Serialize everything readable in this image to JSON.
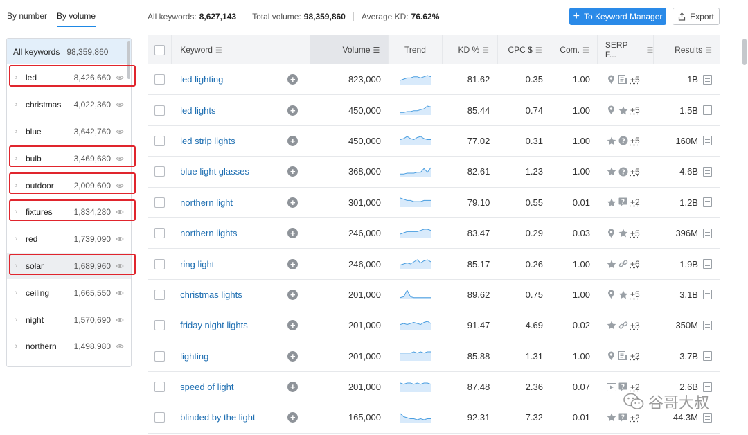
{
  "left_tabs": [
    {
      "label": "By number",
      "active": false
    },
    {
      "label": "By volume",
      "active": true
    }
  ],
  "groups": {
    "all": {
      "name": "All keywords",
      "count": "98,359,860"
    },
    "items": [
      {
        "name": "led",
        "count": "8,426,660",
        "highlighted": true,
        "selected": false
      },
      {
        "name": "christmas",
        "count": "4,022,360",
        "highlighted": false,
        "selected": false
      },
      {
        "name": "blue",
        "count": "3,642,760",
        "highlighted": false,
        "selected": false
      },
      {
        "name": "bulb",
        "count": "3,469,680",
        "highlighted": true,
        "selected": false
      },
      {
        "name": "outdoor",
        "count": "2,009,600",
        "highlighted": true,
        "selected": false
      },
      {
        "name": "fixtures",
        "count": "1,834,280",
        "highlighted": true,
        "selected": false
      },
      {
        "name": "red",
        "count": "1,739,090",
        "highlighted": false,
        "selected": false
      },
      {
        "name": "solar",
        "count": "1,689,960",
        "highlighted": true,
        "selected": true
      },
      {
        "name": "ceiling",
        "count": "1,665,550",
        "highlighted": false,
        "selected": false
      },
      {
        "name": "night",
        "count": "1,570,690",
        "highlighted": false,
        "selected": false
      },
      {
        "name": "northern",
        "count": "1,498,980",
        "highlighted": false,
        "selected": false
      }
    ]
  },
  "stats": {
    "all_keywords_label": "All keywords:",
    "all_keywords_value": "8,627,143",
    "total_volume_label": "Total volume:",
    "total_volume_value": "98,359,860",
    "avg_kd_label": "Average KD:",
    "avg_kd_value": "76.62%"
  },
  "actions": {
    "keyword_manager_label": "To Keyword Manager",
    "export_label": "Export"
  },
  "table": {
    "columns": {
      "keyword": "Keyword",
      "volume": "Volume",
      "trend": "Trend",
      "kd": "KD %",
      "cpc": "CPC $",
      "com": "Com.",
      "serp": "SERP F...",
      "results": "Results"
    },
    "rows": [
      {
        "keyword": "led lighting",
        "volume": "823,000",
        "trend": [
          3,
          4,
          5,
          5,
          6,
          6,
          5,
          6,
          7,
          6
        ],
        "kd": "81.62",
        "cpc": "0.35",
        "com": "1.00",
        "serp_icons": [
          "location-pin-icon",
          "review-icon"
        ],
        "serp_more": "+5",
        "results": "1B"
      },
      {
        "keyword": "led lights",
        "volume": "450,000",
        "trend": [
          2,
          2,
          3,
          3,
          4,
          4,
          5,
          6,
          9,
          8
        ],
        "kd": "85.44",
        "cpc": "0.74",
        "com": "1.00",
        "serp_icons": [
          "location-pin-icon",
          "star-icon"
        ],
        "serp_more": "+5",
        "results": "1.5B"
      },
      {
        "keyword": "led strip lights",
        "volume": "450,000",
        "trend": [
          5,
          6,
          8,
          6,
          5,
          7,
          8,
          6,
          5,
          5
        ],
        "kd": "77.02",
        "cpc": "0.31",
        "com": "1.00",
        "serp_icons": [
          "star-icon",
          "question-icon"
        ],
        "serp_more": "+5",
        "results": "160M"
      },
      {
        "keyword": "blue light glasses",
        "volume": "368,000",
        "trend": [
          2,
          2,
          3,
          3,
          3,
          4,
          4,
          8,
          4,
          9
        ],
        "kd": "82.61",
        "cpc": "1.23",
        "com": "1.00",
        "serp_icons": [
          "star-icon",
          "question-icon"
        ],
        "serp_more": "+5",
        "results": "4.6B"
      },
      {
        "keyword": "northern light",
        "volume": "301,000",
        "trend": [
          7,
          6,
          5,
          5,
          4,
          4,
          4,
          5,
          5,
          5
        ],
        "kd": "79.10",
        "cpc": "0.55",
        "com": "0.01",
        "serp_icons": [
          "star-icon",
          "faq-icon"
        ],
        "serp_more": "+2",
        "results": "1.2B"
      },
      {
        "keyword": "northern lights",
        "volume": "246,000",
        "trend": [
          3,
          4,
          5,
          5,
          5,
          5,
          6,
          7,
          7,
          6
        ],
        "kd": "83.47",
        "cpc": "0.29",
        "com": "0.03",
        "serp_icons": [
          "location-pin-icon",
          "star-icon"
        ],
        "serp_more": "+5",
        "results": "396M"
      },
      {
        "keyword": "ring light",
        "volume": "246,000",
        "trend": [
          3,
          4,
          5,
          4,
          6,
          8,
          5,
          7,
          8,
          6
        ],
        "kd": "85.17",
        "cpc": "0.26",
        "com": "1.00",
        "serp_icons": [
          "star-icon",
          "link-icon"
        ],
        "serp_more": "+6",
        "results": "1.9B"
      },
      {
        "keyword": "christmas lights",
        "volume": "201,000",
        "trend": [
          1,
          2,
          9,
          2,
          1,
          1,
          1,
          1,
          1,
          1
        ],
        "kd": "89.62",
        "cpc": "0.75",
        "com": "1.00",
        "serp_icons": [
          "location-pin-icon",
          "star-icon"
        ],
        "serp_more": "+5",
        "results": "3.1B"
      },
      {
        "keyword": "friday night lights",
        "volume": "201,000",
        "trend": [
          5,
          6,
          5,
          6,
          7,
          6,
          5,
          7,
          8,
          6
        ],
        "kd": "91.47",
        "cpc": "4.69",
        "com": "0.02",
        "serp_icons": [
          "star-icon",
          "link-icon"
        ],
        "serp_more": "+3",
        "results": "350M"
      },
      {
        "keyword": "lighting",
        "volume": "201,000",
        "trend": [
          6,
          6,
          6,
          6,
          7,
          6,
          7,
          6,
          7,
          7
        ],
        "kd": "85.88",
        "cpc": "1.31",
        "com": "1.00",
        "serp_icons": [
          "location-pin-icon",
          "review-icon"
        ],
        "serp_more": "+2",
        "results": "3.7B"
      },
      {
        "keyword": "speed of light",
        "volume": "201,000",
        "trend": [
          7,
          6,
          7,
          7,
          6,
          7,
          6,
          7,
          7,
          6
        ],
        "kd": "87.48",
        "cpc": "2.36",
        "com": "0.07",
        "serp_icons": [
          "video-icon",
          "faq-icon"
        ],
        "serp_more": "+2",
        "results": "2.6B"
      },
      {
        "keyword": "blinded by the light",
        "volume": "165,000",
        "trend": [
          8,
          5,
          4,
          3,
          3,
          2,
          3,
          2,
          3,
          3
        ],
        "kd": "92.31",
        "cpc": "7.32",
        "com": "0.01",
        "serp_icons": [
          "star-icon",
          "faq-icon"
        ],
        "serp_more": "+2",
        "results": "44.3M"
      }
    ]
  },
  "colors": {
    "accent": "#2a8ae8",
    "link": "#1f6fb2",
    "highlight": "#e0252d",
    "trend_line": "#4a9ee0",
    "trend_fill": "#d8eafb"
  },
  "watermark": {
    "text": "谷哥大叔"
  }
}
